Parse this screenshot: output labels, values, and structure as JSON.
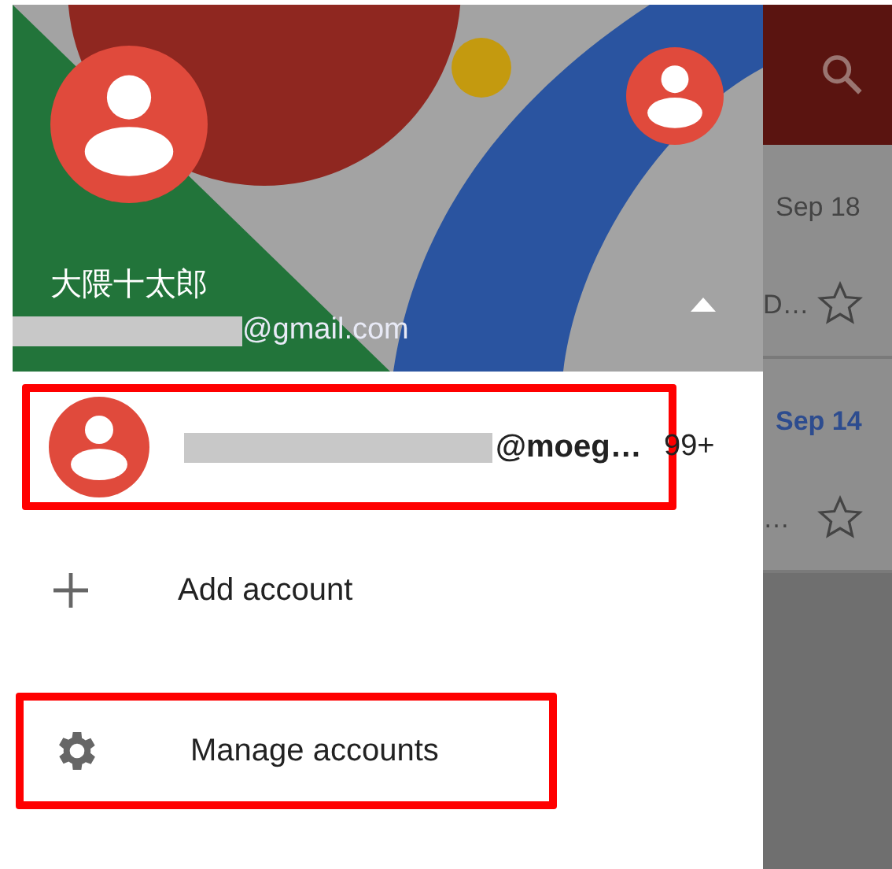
{
  "drawer": {
    "header": {
      "name": "大隈十太郎",
      "email_suffix": "@gmail.com",
      "accounts_expanded": true
    },
    "accounts": [
      {
        "address": "@moeg…",
        "count": "99+",
        "highlighted": true
      }
    ],
    "actions": [
      {
        "kind": "add",
        "label": "Add account",
        "highlighted": false
      },
      {
        "kind": "manage",
        "label": "Manage accounts",
        "highlighted": true
      }
    ]
  },
  "background_inbox": {
    "rows": [
      {
        "date": "Sep 18",
        "snippet": "D…",
        "unread": false,
        "starred": false
      },
      {
        "date": "Sep 14",
        "snippet": "…",
        "unread": true,
        "starred": false
      }
    ]
  }
}
